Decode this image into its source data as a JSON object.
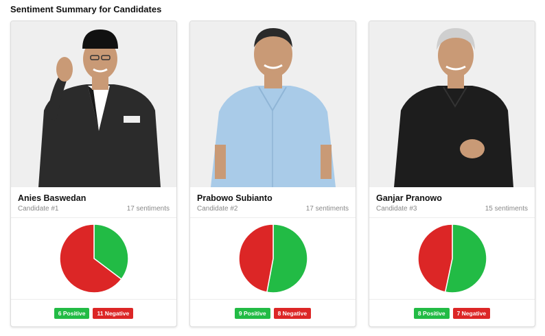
{
  "page_title": "Sentiment Summary for Candidates",
  "colors": {
    "positive": "#22bb45",
    "negative": "#dc2626"
  },
  "candidates": [
    {
      "name": "Anies Baswedan",
      "number": "Candidate #1",
      "sentiments": "17 sentiments",
      "positive_label": "6 Positive",
      "negative_label": "11 Negative",
      "positive": 6,
      "negative": 11,
      "photo": "candidate-1-photo",
      "shirt": "#ffffff",
      "jacket": "#2b2b2b",
      "hat": "#111111"
    },
    {
      "name": "Prabowo Subianto",
      "number": "Candidate #2",
      "sentiments": "17 sentiments",
      "positive_label": "9 Positive",
      "negative_label": "8 Negative",
      "positive": 9,
      "negative": 8,
      "photo": "candidate-2-photo",
      "shirt": "#a9cbe8",
      "jacket": "#a9cbe8",
      "hat": ""
    },
    {
      "name": "Ganjar Pranowo",
      "number": "Candidate #3",
      "sentiments": "15 sentiments",
      "positive_label": "8 Positive",
      "negative_label": "7 Negative",
      "positive": 8,
      "negative": 7,
      "photo": "candidate-3-photo",
      "shirt": "#1d1d1d",
      "jacket": "#1d1d1d",
      "hat": ""
    }
  ],
  "chart_data": [
    {
      "type": "pie",
      "categories": [
        "Positive",
        "Negative"
      ],
      "values": [
        6,
        11
      ]
    },
    {
      "type": "pie",
      "categories": [
        "Positive",
        "Negative"
      ],
      "values": [
        9,
        8
      ]
    },
    {
      "type": "pie",
      "categories": [
        "Positive",
        "Negative"
      ],
      "values": [
        8,
        7
      ]
    }
  ]
}
